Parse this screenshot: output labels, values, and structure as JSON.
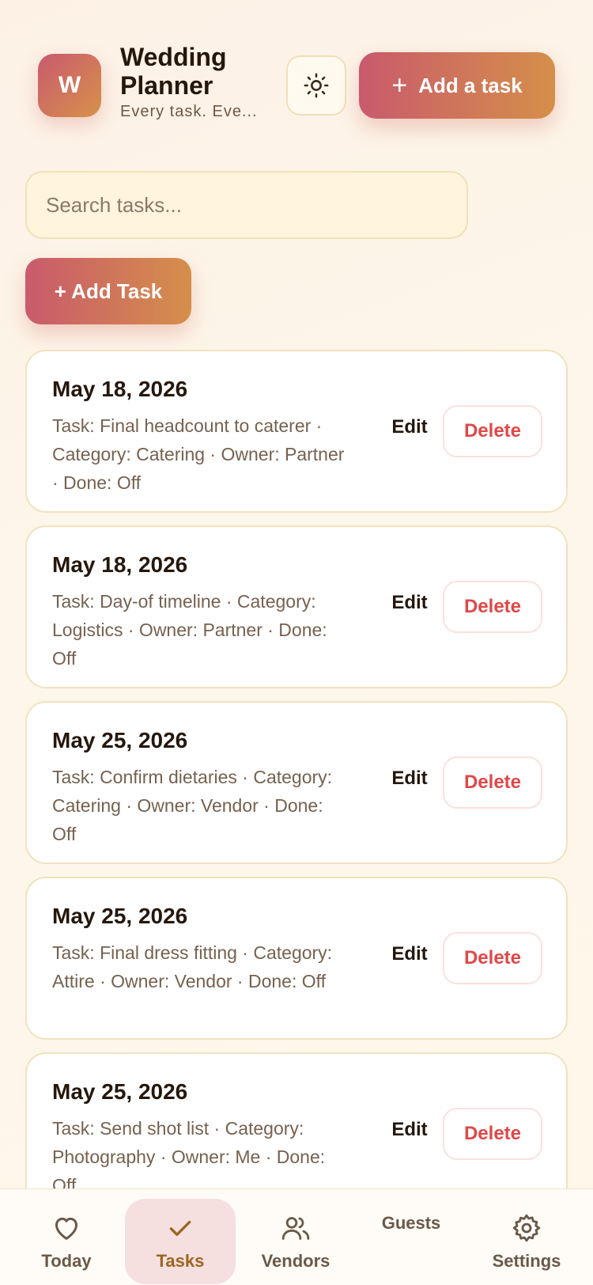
{
  "header": {
    "avatar_letter": "W",
    "title": "Wedding Planner",
    "subtitle": "Every task. Eve...",
    "add_button_label": "Add a task"
  },
  "search": {
    "placeholder": "Search tasks..."
  },
  "add_task_button_label": "+ Add Task",
  "tasks": [
    {
      "date": "May 18, 2026",
      "description": "Task: Final headcount to caterer · Category: Catering · Owner: Partner · Done: Off",
      "edit_label": "Edit",
      "delete_label": "Delete"
    },
    {
      "date": "May 18, 2026",
      "description": "Task: Day-of timeline · Category: Logistics · Owner: Partner · Done: Off",
      "edit_label": "Edit",
      "delete_label": "Delete"
    },
    {
      "date": "May 25, 2026",
      "description": "Task: Confirm dietaries · Category: Catering · Owner: Vendor · Done: Off",
      "edit_label": "Edit",
      "delete_label": "Delete"
    },
    {
      "date": "May 25, 2026",
      "description": "Task: Final dress fitting · Category: Attire · Owner: Vendor · Done: Off",
      "edit_label": "Edit",
      "delete_label": "Delete"
    },
    {
      "date": "May 25, 2026",
      "description": "Task: Send shot list · Category: Photography · Owner: Me · Done: Off",
      "edit_label": "Edit",
      "delete_label": "Delete"
    }
  ],
  "tabbar": {
    "items": [
      {
        "label": "Today",
        "icon": "heart-icon"
      },
      {
        "label": "Tasks",
        "icon": "check-icon",
        "active": true
      },
      {
        "label": "Vendors",
        "icon": "users-icon"
      },
      {
        "label": "Guests",
        "icon": ""
      },
      {
        "label": "Settings",
        "icon": "gear-icon"
      }
    ]
  },
  "colors": {
    "accent_start": "#c95a6c",
    "accent_end": "#d58f4a",
    "delete_red": "#e04848",
    "active_tab_bg": "#f5e0df"
  }
}
